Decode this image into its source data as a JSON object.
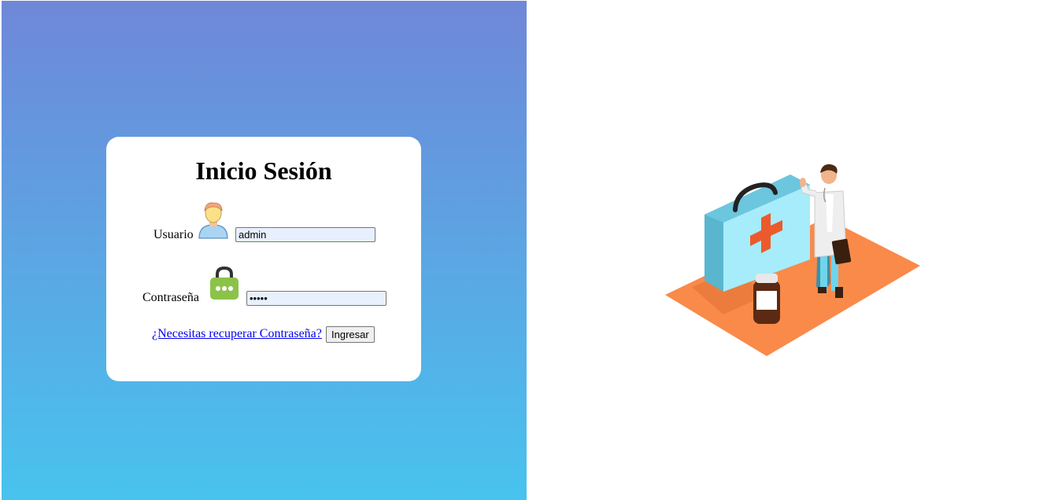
{
  "login": {
    "title": "Inicio Sesión",
    "username_label": "Usuario",
    "username_value": "admin",
    "password_label": "Contraseña",
    "password_value": "•••••",
    "recover_link": "¿Necesitas recuperar Contraseña?",
    "submit_label": "Ingresar"
  },
  "icons": {
    "user": "user-avatar-icon",
    "password": "padlock-icon"
  },
  "colors": {
    "gradient_top": "#6f87d8",
    "gradient_bottom": "#48c3ee",
    "input_bg": "#e8f0fe",
    "link": "#0000ee"
  }
}
